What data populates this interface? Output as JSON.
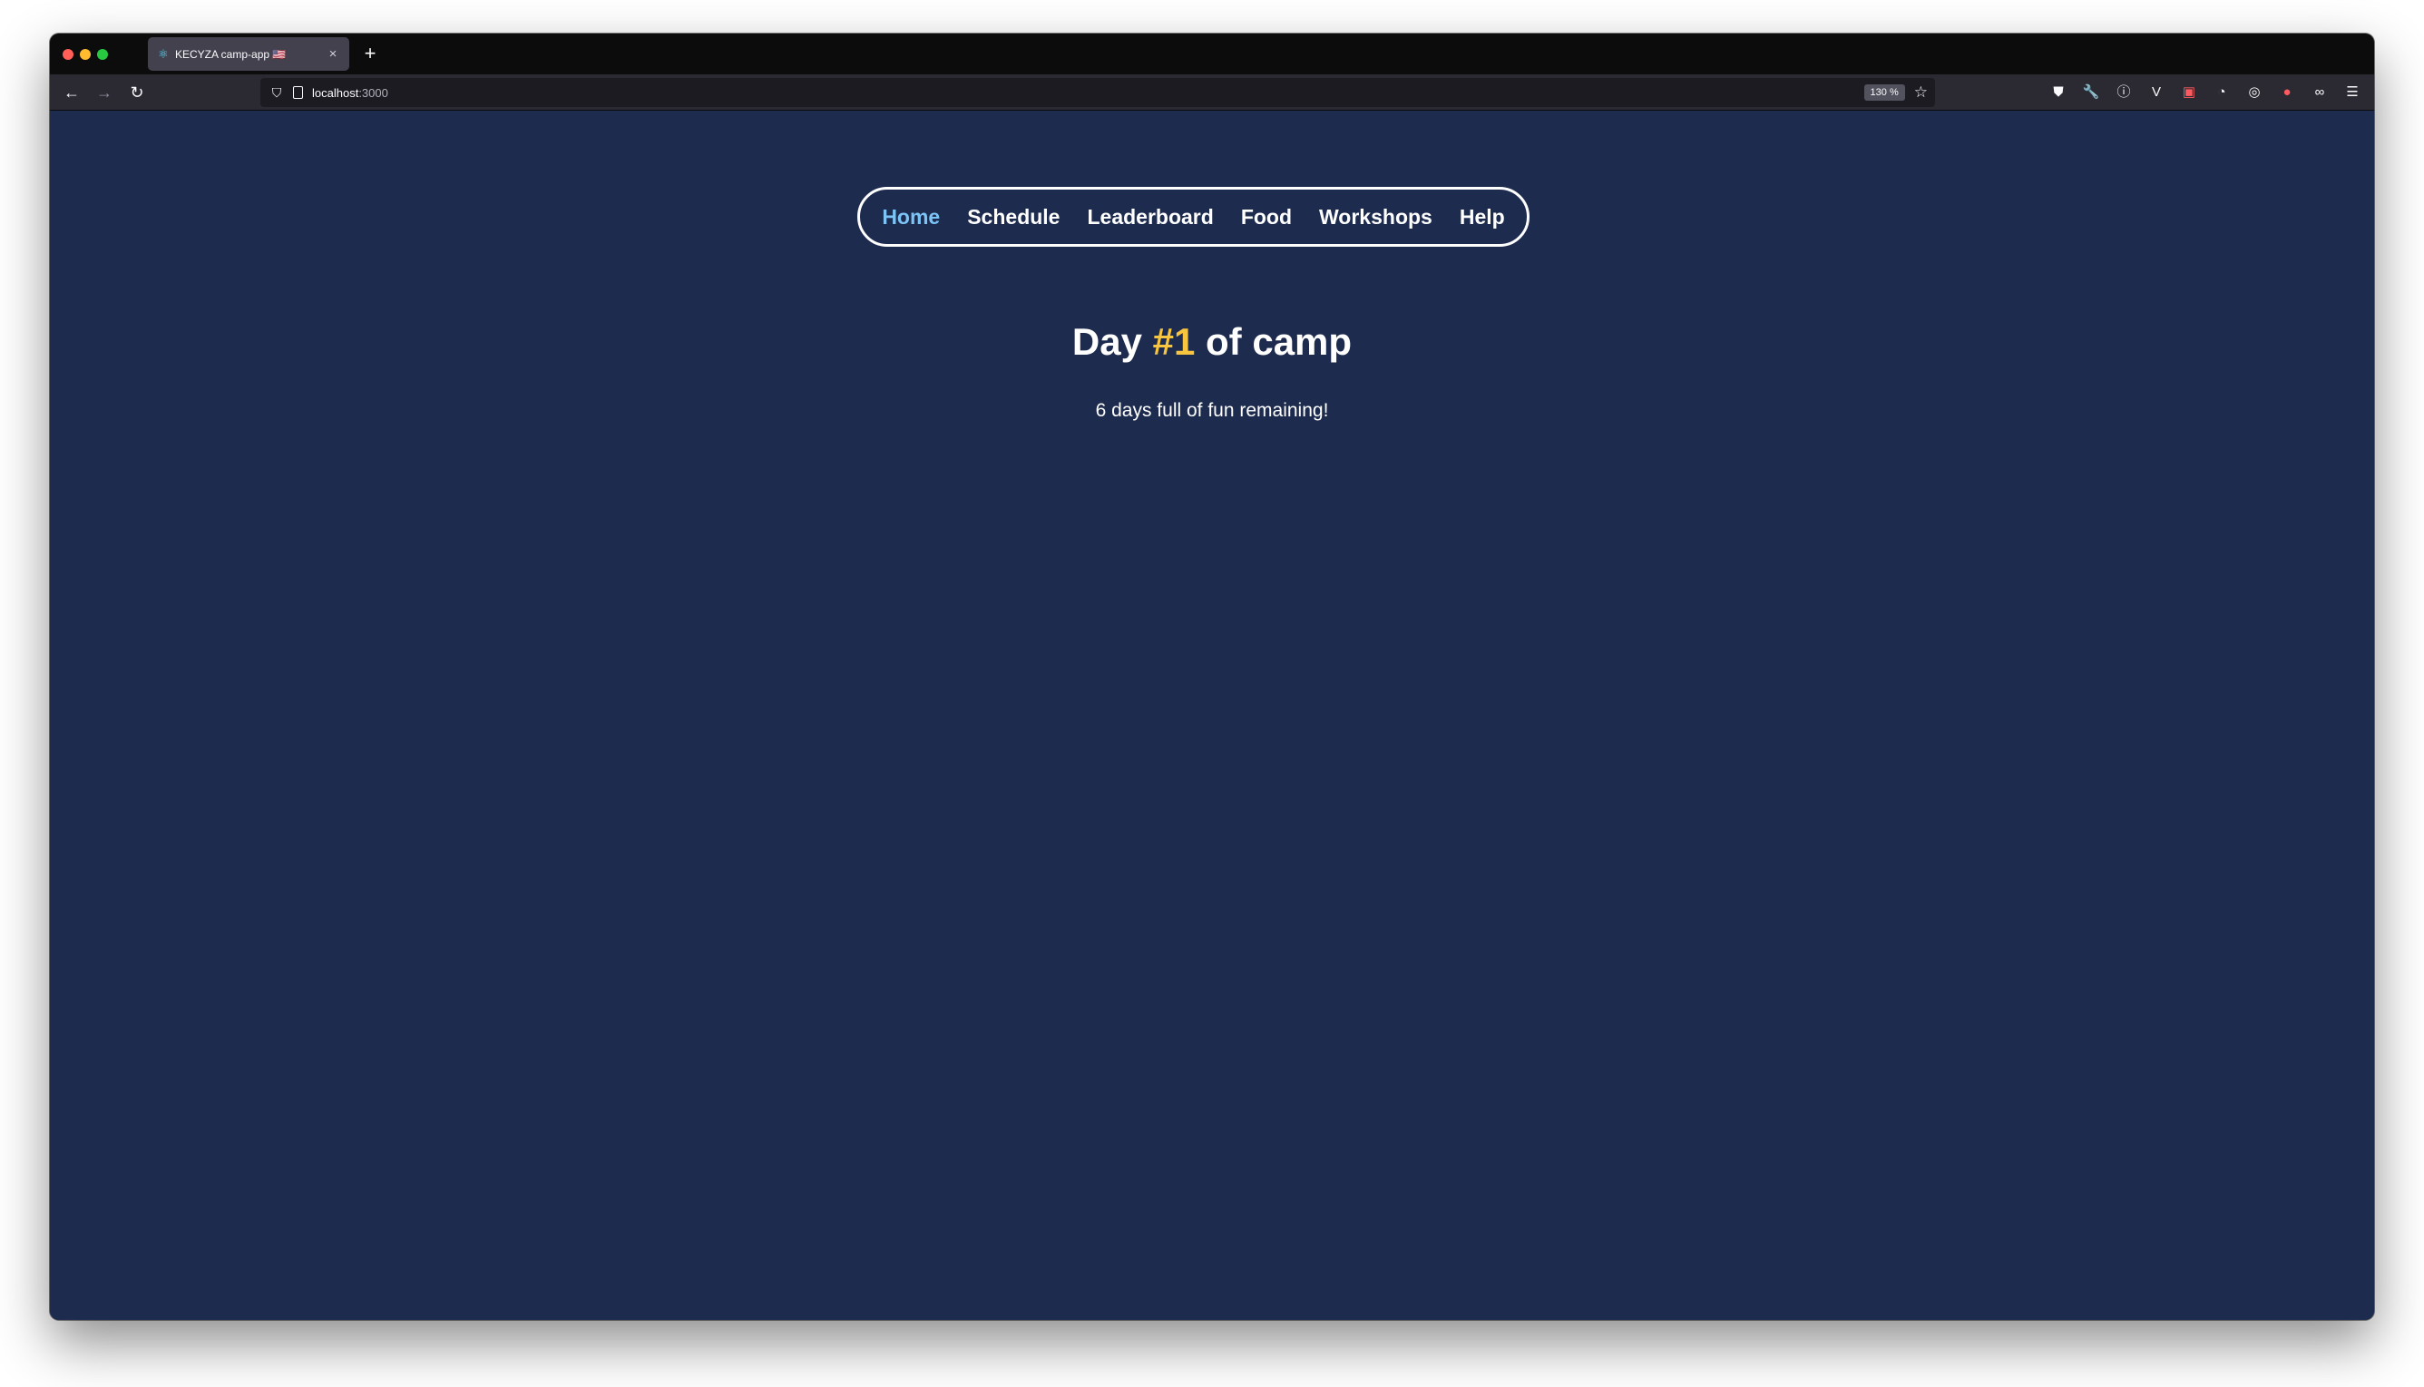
{
  "browser": {
    "tab": {
      "title": "KECYZA camp-app 🇺🇸",
      "favicon": "react-icon"
    },
    "url": {
      "host": "localhost",
      "port": ":3000"
    },
    "zoom": "130 %"
  },
  "site": {
    "nav": [
      {
        "label": "Home",
        "active": true
      },
      {
        "label": "Schedule"
      },
      {
        "label": "Leaderboard"
      },
      {
        "label": "Food"
      },
      {
        "label": "Workshops"
      },
      {
        "label": "Help"
      }
    ],
    "headline": {
      "prefix": "Day ",
      "number": "#1",
      "suffix": " of camp"
    },
    "subline": "6 days full of fun remaining!",
    "colors": {
      "background": "#1d2b4e",
      "active_link": "#7cc4f5",
      "highlight": "#f7c53f"
    }
  }
}
